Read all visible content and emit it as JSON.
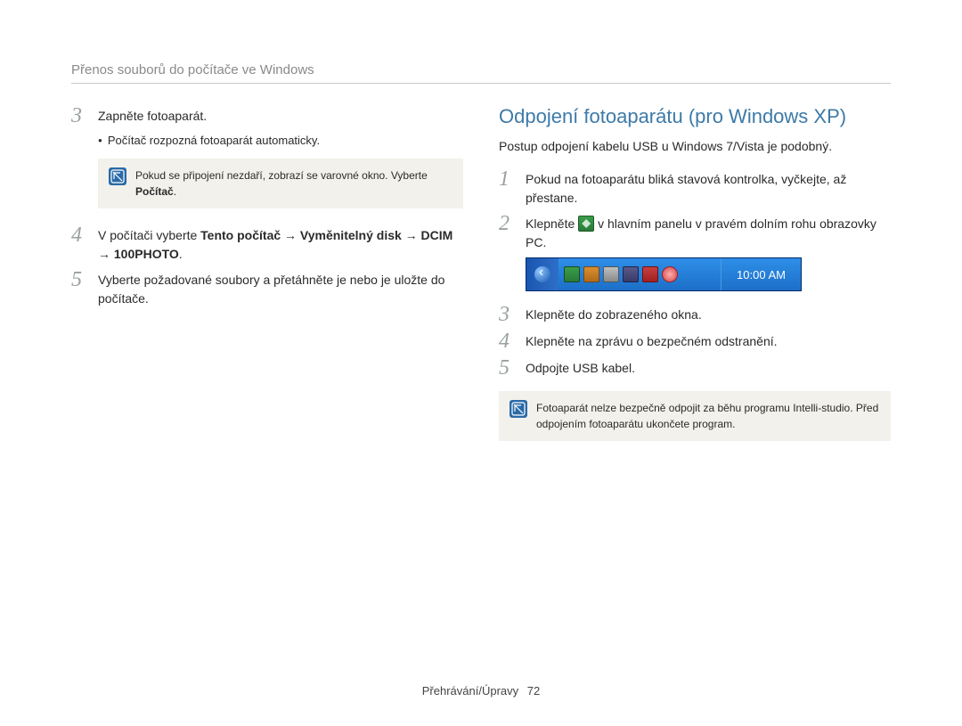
{
  "header": "Přenos souborů do počítače ve Windows",
  "left": {
    "step3": {
      "num": "3",
      "text": "Zapněte fotoaparát."
    },
    "step3_sub": "Počítač rozpozná fotoaparát automaticky.",
    "note1_a": "Pokud se připojení nezdaří, zobrazí se varovné okno. Vyberte ",
    "note1_b": "Počítač",
    "note1_c": ".",
    "step4": {
      "num": "4",
      "pre": "V počítači vyberte ",
      "bold": "Tento počítač → Vyměnitelný disk → DCIM → 100PHOTO",
      "post": "."
    },
    "step5": {
      "num": "5",
      "text": "Vyberte požadované soubory a přetáhněte je nebo je uložte do počítače."
    }
  },
  "right": {
    "title": "Odpojení fotoaparátu (pro Windows XP)",
    "intro": "Postup odpojení kabelu USB u Windows 7/Vista je podobný.",
    "step1": {
      "num": "1",
      "text": "Pokud na fotoaparátu bliká stavová kontrolka, vyčkejte, až přestane."
    },
    "step2": {
      "num": "2",
      "pre": "Klepněte ",
      "post": " v hlavním panelu v pravém dolním rohu obrazovky PC."
    },
    "taskbar_time": "10:00 AM",
    "step3": {
      "num": "3",
      "text": "Klepněte do zobrazeného okna."
    },
    "step4": {
      "num": "4",
      "text": "Klepněte na zprávu o bezpečném odstranění."
    },
    "step5": {
      "num": "5",
      "text": "Odpojte USB kabel."
    },
    "note2": "Fotoaparát nelze bezpečně odpojit za běhu programu Intelli-studio. Před odpojením fotoaparátu ukončete program."
  },
  "footer": {
    "section": "Přehrávání/Úpravy",
    "page": "72"
  }
}
